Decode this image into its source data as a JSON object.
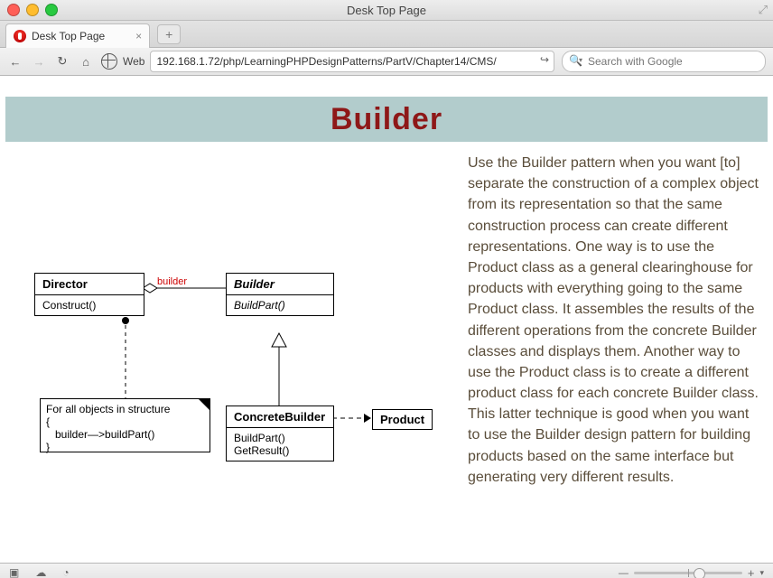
{
  "window": {
    "title": "Desk Top Page"
  },
  "tab": {
    "title": "Desk Top Page"
  },
  "toolbar": {
    "web_label": "Web",
    "address": "192.168.1.72/php/LearningPHPDesignPatterns/PartV/Chapter14/CMS/",
    "search_placeholder": "Search with Google"
  },
  "page": {
    "banner_title": "Builder",
    "description": "Use the Builder pattern when you want [to] separate the construction of a complex object from its representation so that the same construction process can create different representations. One way is to use the Product class as a general clearinghouse for products with everything going to the same Product class. It assembles the results of the different operations from the concrete Builder classes and displays them. Another way to use the Product class is to create a different product class for each concrete Builder class. This latter technique is good when you want to use the Builder design pattern for building products based on the same interface but generating very different results."
  },
  "uml": {
    "director": {
      "name": "Director",
      "method": "Construct()"
    },
    "builder": {
      "name": "Builder",
      "method": "BuildPart()"
    },
    "concrete": {
      "name": "ConcreteBuilder",
      "method1": "BuildPart()",
      "method2": "GetResult()"
    },
    "product": {
      "name": "Product"
    },
    "assoc_label": "builder",
    "note_line1": "For all objects in structure",
    "note_line2": "{",
    "note_line3": "   builder—>buildPart()",
    "note_line4": "}"
  }
}
